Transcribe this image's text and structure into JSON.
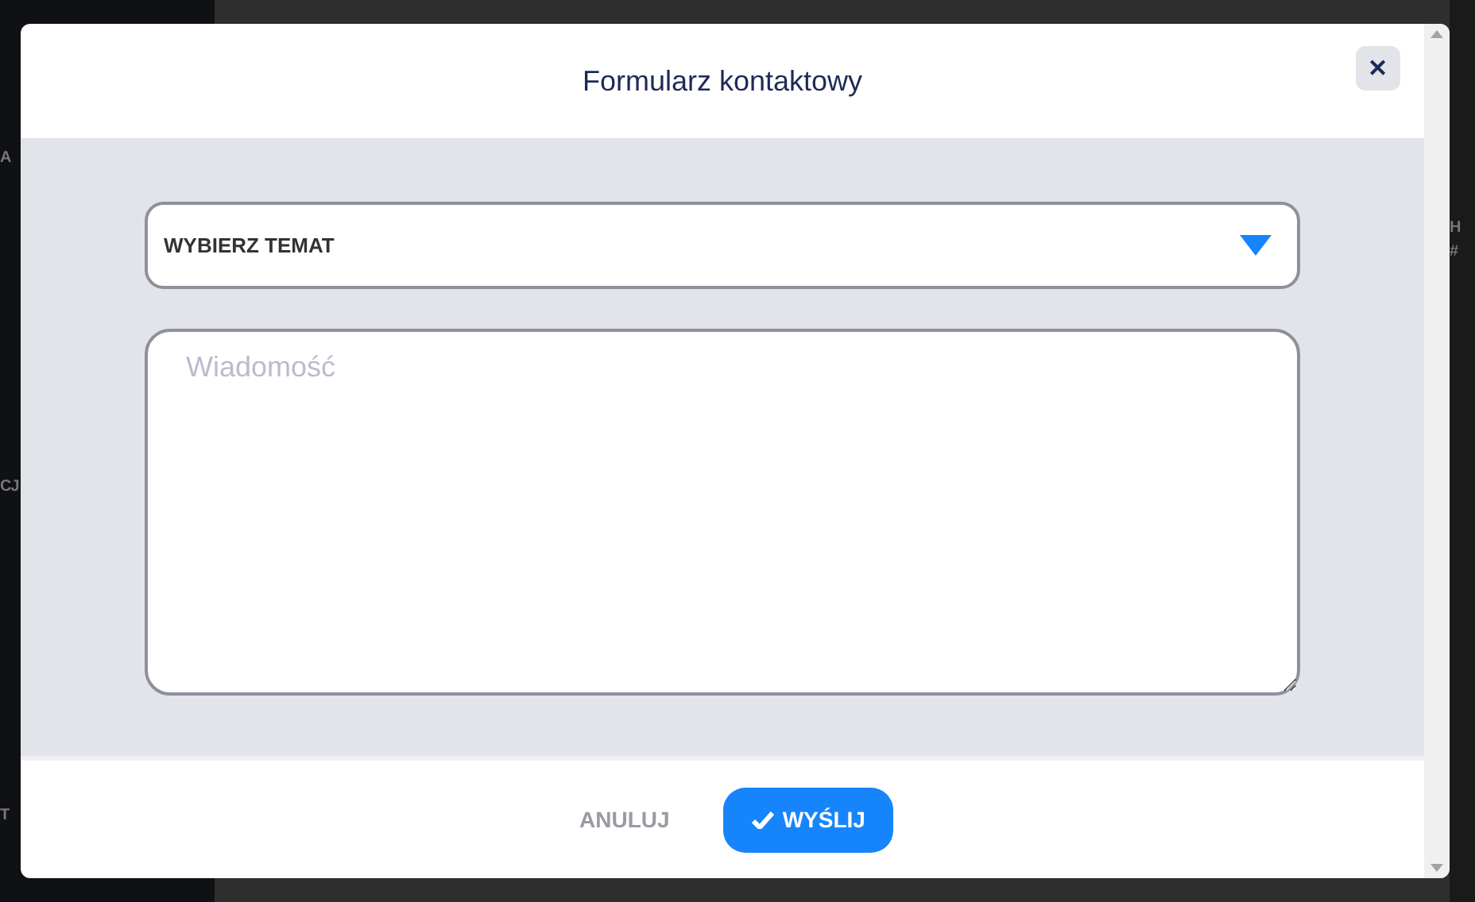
{
  "backdrop": {
    "left_texts": [
      "A",
      "CJ",
      "T"
    ],
    "right_texts": [
      "H",
      "#"
    ]
  },
  "dialog": {
    "title": "Formularz kontaktowy",
    "close_icon": "✕",
    "topic_select": {
      "value": "WYBIERZ TEMAT"
    },
    "message": {
      "placeholder": "Wiadomość"
    },
    "buttons": [
      {
        "label": "ANULUJ",
        "kind": "text"
      },
      {
        "label": "WYŚLIJ",
        "kind": "primary"
      }
    ]
  }
}
